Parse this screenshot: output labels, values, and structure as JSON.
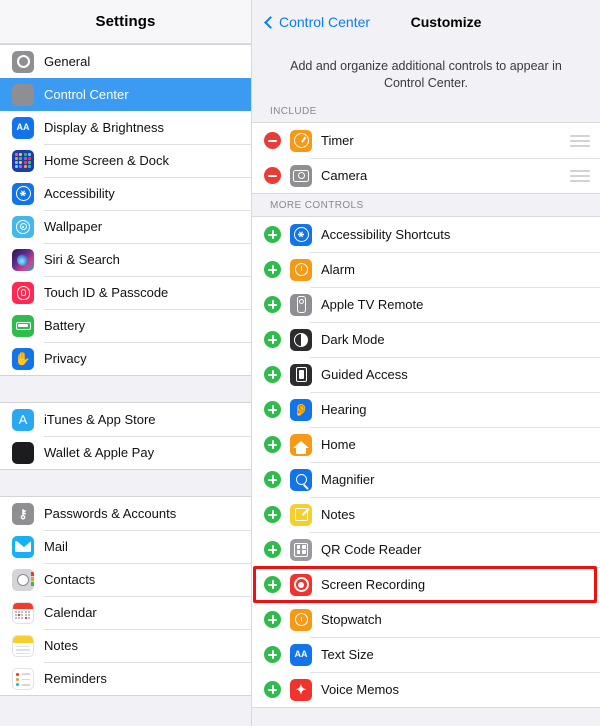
{
  "sidebar": {
    "title": "Settings",
    "groups": [
      {
        "items": [
          {
            "label": "General",
            "icon": "gear-icon",
            "selected": false
          },
          {
            "label": "Control Center",
            "icon": "control-center-icon",
            "selected": true
          },
          {
            "label": "Display & Brightness",
            "icon": "display-brightness-icon",
            "selected": false
          },
          {
            "label": "Home Screen & Dock",
            "icon": "home-screen-dock-icon",
            "selected": false
          },
          {
            "label": "Accessibility",
            "icon": "accessibility-icon",
            "selected": false
          },
          {
            "label": "Wallpaper",
            "icon": "wallpaper-icon",
            "selected": false
          },
          {
            "label": "Siri & Search",
            "icon": "siri-search-icon",
            "selected": false
          },
          {
            "label": "Touch ID & Passcode",
            "icon": "touch-id-icon",
            "selected": false
          },
          {
            "label": "Battery",
            "icon": "battery-icon",
            "selected": false
          },
          {
            "label": "Privacy",
            "icon": "privacy-icon",
            "selected": false
          }
        ]
      },
      {
        "items": [
          {
            "label": "iTunes & App Store",
            "icon": "itunes-app-store-icon",
            "selected": false
          },
          {
            "label": "Wallet & Apple Pay",
            "icon": "wallet-apple-pay-icon",
            "selected": false
          }
        ]
      },
      {
        "items": [
          {
            "label": "Passwords & Accounts",
            "icon": "passwords-accounts-icon",
            "selected": false
          },
          {
            "label": "Mail",
            "icon": "mail-icon",
            "selected": false
          },
          {
            "label": "Contacts",
            "icon": "contacts-icon",
            "selected": false
          },
          {
            "label": "Calendar",
            "icon": "calendar-icon",
            "selected": false
          },
          {
            "label": "Notes",
            "icon": "notes-icon",
            "selected": false
          },
          {
            "label": "Reminders",
            "icon": "reminders-icon",
            "selected": false
          }
        ]
      }
    ]
  },
  "detail": {
    "back_label": "Control Center",
    "title": "Customize",
    "blurb": "Add and organize additional controls to appear in Control Center.",
    "include_header": "INCLUDE",
    "more_header": "MORE CONTROLS",
    "include": [
      {
        "label": "Timer",
        "icon": "timer-icon",
        "action": "remove"
      },
      {
        "label": "Camera",
        "icon": "camera-icon",
        "action": "remove"
      }
    ],
    "more": [
      {
        "label": "Accessibility Shortcuts",
        "icon": "accessibility-shortcuts-icon",
        "action": "add",
        "highlighted": false
      },
      {
        "label": "Alarm",
        "icon": "alarm-icon",
        "action": "add",
        "highlighted": false
      },
      {
        "label": "Apple TV Remote",
        "icon": "apple-tv-remote-icon",
        "action": "add",
        "highlighted": false
      },
      {
        "label": "Dark Mode",
        "icon": "dark-mode-icon",
        "action": "add",
        "highlighted": false
      },
      {
        "label": "Guided Access",
        "icon": "guided-access-icon",
        "action": "add",
        "highlighted": false
      },
      {
        "label": "Hearing",
        "icon": "hearing-icon",
        "action": "add",
        "highlighted": false
      },
      {
        "label": "Home",
        "icon": "home-icon",
        "action": "add",
        "highlighted": false
      },
      {
        "label": "Magnifier",
        "icon": "magnifier-icon",
        "action": "add",
        "highlighted": false
      },
      {
        "label": "Notes",
        "icon": "notes-app-icon",
        "action": "add",
        "highlighted": false
      },
      {
        "label": "QR Code Reader",
        "icon": "qr-code-reader-icon",
        "action": "add",
        "highlighted": false
      },
      {
        "label": "Screen Recording",
        "icon": "screen-recording-icon",
        "action": "add",
        "highlighted": true
      },
      {
        "label": "Stopwatch",
        "icon": "stopwatch-icon",
        "action": "add",
        "highlighted": false
      },
      {
        "label": "Text Size",
        "icon": "text-size-icon",
        "action": "add",
        "highlighted": false
      },
      {
        "label": "Voice Memos",
        "icon": "voice-memos-icon",
        "action": "add",
        "highlighted": false
      }
    ]
  },
  "colors": {
    "selection_blue": "#3b9bf2",
    "link_blue": "#0a7cf6",
    "add_green": "#2fbc4d",
    "remove_red": "#ea3b37",
    "highlight_red": "#ee1111",
    "panel_bg": "#f1f1f6"
  },
  "icon_glyphs": {
    "display_brightness": "AA",
    "text_size": "AA",
    "privacy": "✋",
    "itunes": "A",
    "passwords": "⚷",
    "hearing": "👂",
    "voice_memos": "✦"
  }
}
